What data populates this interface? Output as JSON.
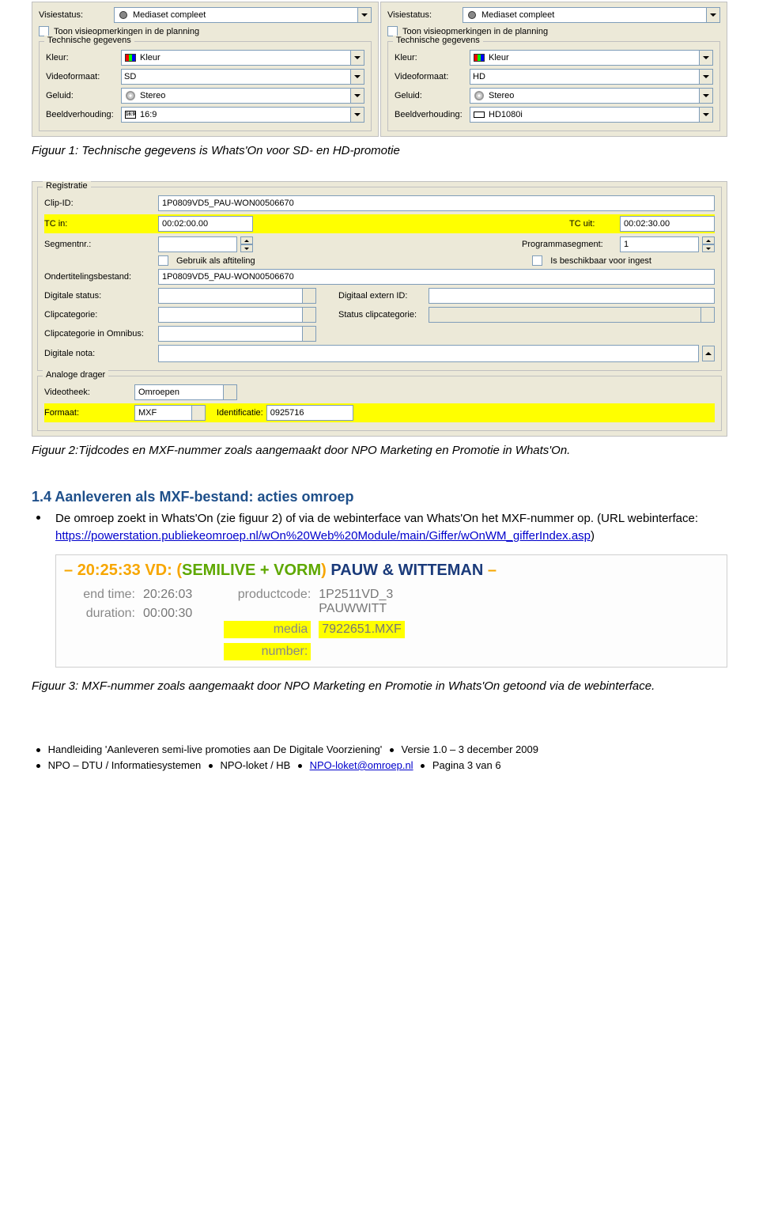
{
  "top_panels": {
    "left": {
      "visiestatus_label": "Visiestatus:",
      "visiestatus_value": "Mediaset compleet",
      "checkbox_label": "Toon visieopmerkingen in de planning",
      "group_title": "Technische gegevens",
      "kleur_label": "Kleur:",
      "kleur_value": "Kleur",
      "videoformaat_label": "Videoformaat:",
      "videoformaat_value": "SD",
      "geluid_label": "Geluid:",
      "geluid_value": "Stereo",
      "beeldverhouding_label": "Beeldverhouding:",
      "beeldverhouding_value": "16:9"
    },
    "right": {
      "visiestatus_label": "Visiestatus:",
      "visiestatus_value": "Mediaset compleet",
      "checkbox_label": "Toon visieopmerkingen in de planning",
      "group_title": "Technische gegevens",
      "kleur_label": "Kleur:",
      "kleur_value": "Kleur",
      "videoformaat_label": "Videoformaat:",
      "videoformaat_value": "HD",
      "geluid_label": "Geluid:",
      "geluid_value": "Stereo",
      "beeldverhouding_label": "Beeldverhouding:",
      "beeldverhouding_value": "HD1080i"
    }
  },
  "figure1_caption": "Figuur 1: Technische gegevens is Whats'On voor SD- en HD-promotie",
  "reg_panel": {
    "registratie_title": "Registratie",
    "clip_id_label": "Clip-ID:",
    "clip_id_value": "1P0809VD5_PAU-WON00506670",
    "tc_in_label": "TC in:",
    "tc_in_value": "00:02:00.00",
    "tc_uit_label": "TC uit:",
    "tc_uit_value": "00:02:30.00",
    "segmentnr_label": "Segmentnr.:",
    "segmentnr_value": "",
    "programmasegment_label": "Programmasegment:",
    "programmasegment_value": "1",
    "gebruik_aftiteling": "Gebruik als aftiteling",
    "beschikbaar_ingest": "Is beschikbaar voor ingest",
    "ondertiteling_label": "Ondertitelingsbestand:",
    "ondertiteling_value": "1P0809VD5_PAU-WON00506670",
    "digitale_status_label": "Digitale status:",
    "digitaal_extern_label": "Digitaal extern ID:",
    "clipcategorie_label": "Clipcategorie:",
    "status_clipcategorie_label": "Status clipcategorie:",
    "clipcategorie_omnibus_label": "Clipcategorie in Omnibus:",
    "digitale_nota_label": "Digitale nota:",
    "analoge_title": "Analoge drager",
    "videotheek_label": "Videotheek:",
    "videotheek_value": "Omroepen",
    "formaat_label": "Formaat:",
    "formaat_value": "MXF",
    "identificatie_label": "Identificatie:",
    "identificatie_value": "0925716"
  },
  "figure2_caption": "Figuur 2:Tijdcodes en MXF-nummer zoals aangemaakt door NPO Marketing en Promotie in Whats'On.",
  "section": {
    "heading_num": "1.4",
    "heading_title": "Aanleveren als MXF-bestand: acties omroep",
    "bullet_text_1": "De omroep zoekt in Whats'On (zie figuur 2) of via de webinterface van Whats'On het MXF-nummer op. (URL webinterface: ",
    "bullet_link": "https://powerstation.publiekeomroep.nl/wOn%20Web%20Module/main/Giffer/wOnWM_gifferIndex.asp",
    "bullet_text_2": ")"
  },
  "giffer": {
    "dash": "–",
    "time": "20:25:33",
    "vd": "VD:",
    "open": "(",
    "semilive": "SEMILIVE + VORM",
    "close": ")",
    "pw": "PAUW & WITTEMAN",
    "end_time_label": "end time:",
    "end_time_value": "20:26:03",
    "duration_label": "duration:",
    "duration_value": "00:00:30",
    "productcode_label": "productcode:",
    "productcode_value": "1P2511VD_3 PAUWWITT",
    "media_label": "media",
    "media_value": "7922651.MXF",
    "number_label": "number:"
  },
  "figure3_caption": "Figuur 3: MXF-nummer zoals aangemaakt door NPO Marketing en Promotie in Whats'On getoond via de webinterface.",
  "footer": {
    "l1a": "Handleiding 'Aanleveren semi-live promoties aan De Digitale Voorziening'",
    "l1b": "Versie 1.0 – 3 december 2009",
    "l2a": "NPO – DTU / Informatiesystemen",
    "l2b": "NPO-loket / HB",
    "l2_link": "NPO-loket@omroep.nl",
    "l2c": "Pagina 3 van 6"
  }
}
